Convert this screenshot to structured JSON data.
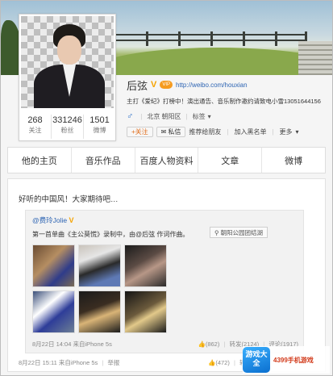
{
  "profile": {
    "name": "后弦",
    "verified_mark": "V",
    "vip_label": "VIP",
    "url": "http://weibo.com/houxian",
    "intro": "主打《爱纪》打榜中！演出通告、音乐制作邀约请致电小雪13051644156",
    "gender_symbol": "♂",
    "location": "北京 朝阳区",
    "tags_label": "标签",
    "stats": [
      {
        "value": "268",
        "label": "关注"
      },
      {
        "value": "331246",
        "label": "粉丝"
      },
      {
        "value": "1501",
        "label": "微博"
      }
    ],
    "actions": {
      "follow": "+关注",
      "message": "私信",
      "recommend": "推荐给朋友",
      "blacklist": "加入黑名单",
      "more": "更多"
    }
  },
  "tabs": [
    "他的主页",
    "音乐作品",
    "百度人物资料",
    "文章",
    "微博"
  ],
  "post": {
    "text": "好听的中国风！大家期待吧…",
    "repost": {
      "author": "@费玲Jolie",
      "text": "第一首单曲《主公莫慌》录制中，由@后弦 作词作曲。",
      "location": "朝阳公园团结湖",
      "time": "8月22日 14:04",
      "source": "来自iPhone 5s",
      "likes": "(862)",
      "reposts": "转发(2124)",
      "comments": "评论(1917)"
    },
    "time": "8月22日 15:11",
    "source": "来自iPhone 5s",
    "report": "举报",
    "likes": "(472)",
    "reposts": "转发"
  },
  "watermark": {
    "logo_text": "游戏大全",
    "text": "4399手机游戏"
  }
}
